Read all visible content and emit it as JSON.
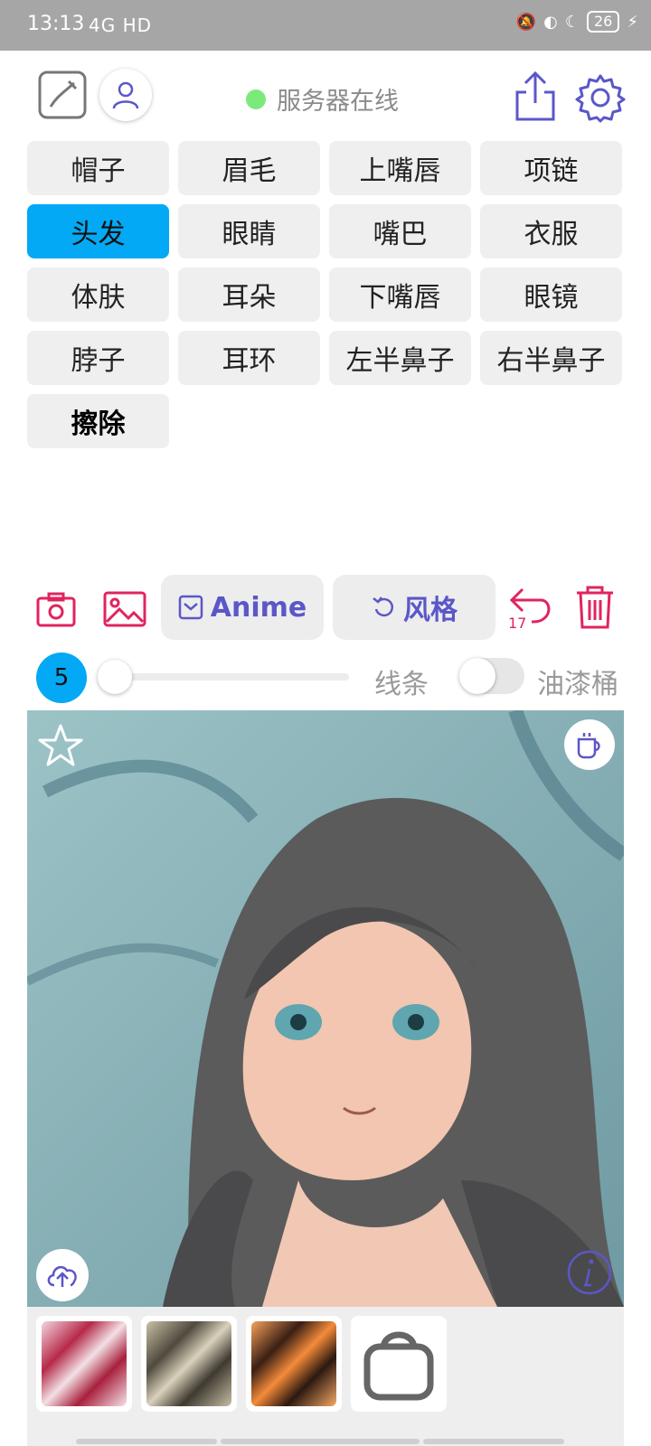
{
  "status_bar": {
    "time": "13:13",
    "network": "4G HD",
    "battery": "26"
  },
  "server": {
    "status_text": "服务器在线",
    "status_color": "#7cea7a"
  },
  "categories": {
    "items": [
      "帽子",
      "眉毛",
      "上嘴唇",
      "项链",
      "头发",
      "眼睛",
      "嘴巴",
      "衣服",
      "体肤",
      "耳朵",
      "下嘴唇",
      "眼镜",
      "脖子",
      "耳环",
      "左半鼻子",
      "右半鼻子",
      "擦除"
    ],
    "active": "头发",
    "active_color": "#03a9f4"
  },
  "toolbar": {
    "anime_label": "Anime",
    "style_label": "风格",
    "undo_count": "17"
  },
  "brush": {
    "size": "5",
    "line_label": "线条",
    "bucket_label": "油漆桶"
  },
  "icons": [
    "draw-icon",
    "user-icon",
    "share-icon",
    "gear-icon",
    "camera-icon",
    "image-icon",
    "anime-icon",
    "refresh-icon",
    "undo-icon",
    "trash-icon",
    "star-icon",
    "cup-icon",
    "upload-icon",
    "info-icon",
    "bag-icon"
  ],
  "colors": {
    "accent_blue": "#03a9f4",
    "purple": "#5b57c8",
    "red": "#e0245e"
  }
}
